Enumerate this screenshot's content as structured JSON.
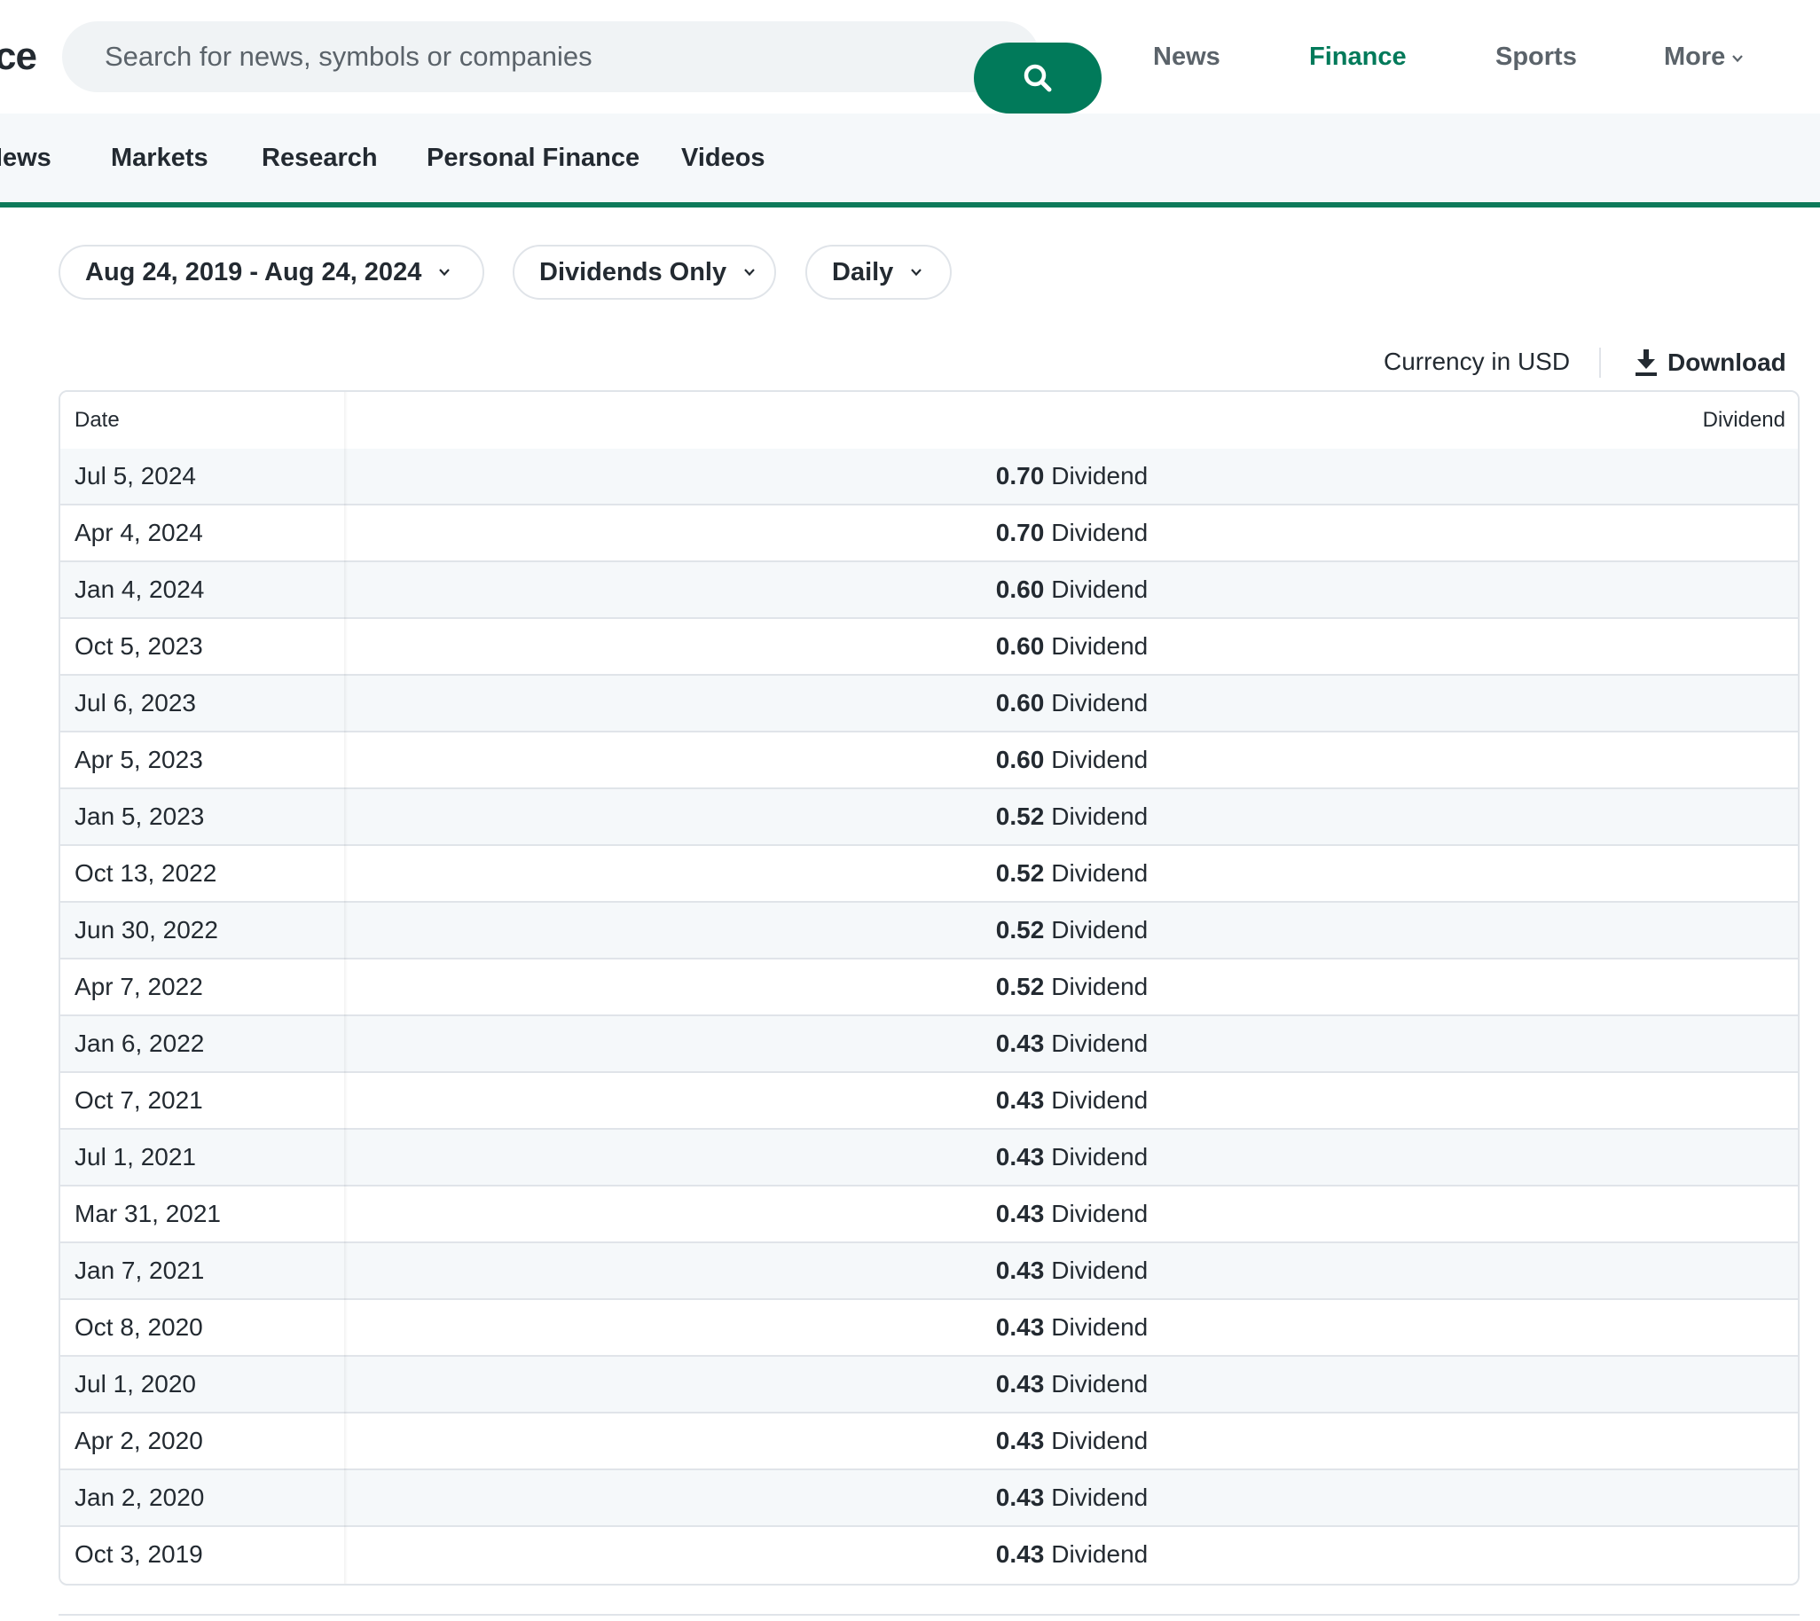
{
  "header": {
    "brand_fragment": "ce",
    "search": {
      "placeholder": "Search for news, symbols or companies"
    },
    "nav": [
      {
        "label": "News"
      },
      {
        "label": "Finance",
        "active": true
      },
      {
        "label": "Sports"
      },
      {
        "label": "More"
      }
    ]
  },
  "subnav": {
    "items": [
      {
        "label": "News"
      },
      {
        "label": "Markets"
      },
      {
        "label": "Research"
      },
      {
        "label": "Personal Finance"
      },
      {
        "label": "Videos"
      }
    ]
  },
  "filters": {
    "date_range": "Aug 24, 2019 - Aug 24, 2024",
    "show": "Dividends Only",
    "frequency": "Daily"
  },
  "toolbar": {
    "currency": "Currency in USD",
    "download": "Download"
  },
  "table": {
    "columns": [
      "Date",
      "Dividend"
    ],
    "rows": [
      {
        "date": "Jul 5, 2024",
        "amount": "0.70",
        "type": "Dividend"
      },
      {
        "date": "Apr 4, 2024",
        "amount": "0.70",
        "type": "Dividend"
      },
      {
        "date": "Jan 4, 2024",
        "amount": "0.60",
        "type": "Dividend"
      },
      {
        "date": "Oct 5, 2023",
        "amount": "0.60",
        "type": "Dividend"
      },
      {
        "date": "Jul 6, 2023",
        "amount": "0.60",
        "type": "Dividend"
      },
      {
        "date": "Apr 5, 2023",
        "amount": "0.60",
        "type": "Dividend"
      },
      {
        "date": "Jan 5, 2023",
        "amount": "0.52",
        "type": "Dividend"
      },
      {
        "date": "Oct 13, 2022",
        "amount": "0.52",
        "type": "Dividend"
      },
      {
        "date": "Jun 30, 2022",
        "amount": "0.52",
        "type": "Dividend"
      },
      {
        "date": "Apr 7, 2022",
        "amount": "0.52",
        "type": "Dividend"
      },
      {
        "date": "Jan 6, 2022",
        "amount": "0.43",
        "type": "Dividend"
      },
      {
        "date": "Oct 7, 2021",
        "amount": "0.43",
        "type": "Dividend"
      },
      {
        "date": "Jul 1, 2021",
        "amount": "0.43",
        "type": "Dividend"
      },
      {
        "date": "Mar 31, 2021",
        "amount": "0.43",
        "type": "Dividend"
      },
      {
        "date": "Jan 7, 2021",
        "amount": "0.43",
        "type": "Dividend"
      },
      {
        "date": "Oct 8, 2020",
        "amount": "0.43",
        "type": "Dividend"
      },
      {
        "date": "Jul 1, 2020",
        "amount": "0.43",
        "type": "Dividend"
      },
      {
        "date": "Apr 2, 2020",
        "amount": "0.43",
        "type": "Dividend"
      },
      {
        "date": "Jan 2, 2020",
        "amount": "0.43",
        "type": "Dividend"
      },
      {
        "date": "Oct 3, 2019",
        "amount": "0.43",
        "type": "Dividend"
      }
    ]
  },
  "icons": {
    "search": "search-icon",
    "more": "chevron-down-icon",
    "dropdown": "chevron-down-icon",
    "download": "download-icon"
  },
  "colors": {
    "accent": "#017a5a",
    "nav_active": "#017a5a",
    "text": "#232a31",
    "muted": "#5b636a",
    "row_alt": "#f5f8fa",
    "border": "#e0e4e9"
  }
}
